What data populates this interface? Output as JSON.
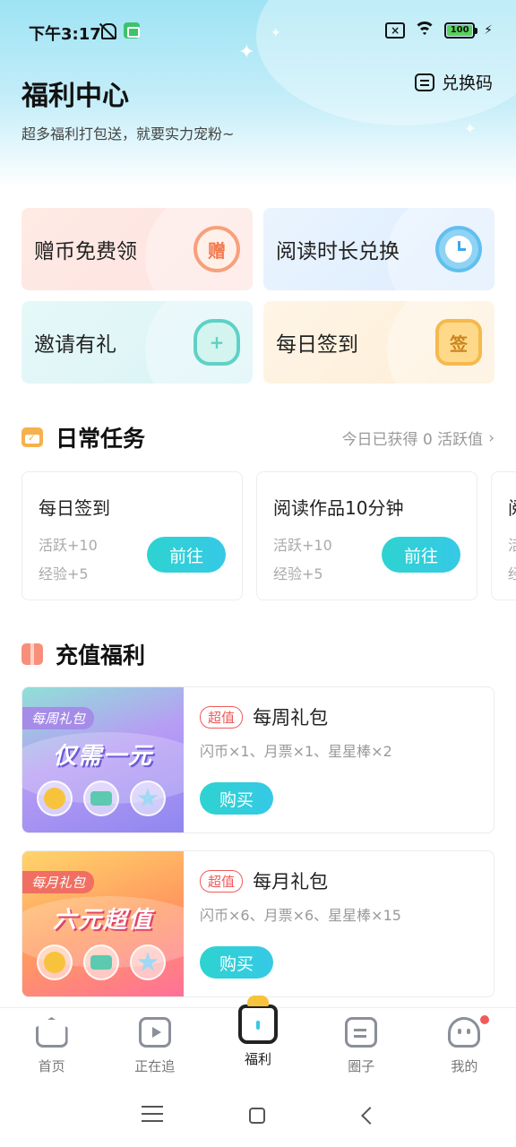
{
  "status_bar": {
    "time": "下午3:17",
    "battery": "100"
  },
  "header": {
    "title": "福利中心",
    "subtitle": "超多福利打包送，就要实力宠粉~",
    "redeem_label": "兑换码"
  },
  "features": [
    {
      "label": "赠币免费领",
      "icon": "gift-coin-icon",
      "icon_text": "赠"
    },
    {
      "label": "阅读时长兑换",
      "icon": "alarm-clock-icon"
    },
    {
      "label": "邀请有礼",
      "icon": "invite-user-icon"
    },
    {
      "label": "每日签到",
      "icon": "sign-in-badge-icon",
      "icon_text": "签"
    }
  ],
  "daily_tasks": {
    "title": "日常任务",
    "meta": "今日已获得 0 活跃值",
    "tasks": [
      {
        "name": "每日签到",
        "reward1": "活跃+10",
        "reward2": "经验+5",
        "button": "前往"
      },
      {
        "name": "阅读作品10分钟",
        "reward1": "活跃+10",
        "reward2": "经验+5",
        "button": "前往"
      },
      {
        "name": "阅",
        "reward1": "活",
        "reward2": "经",
        "button": ""
      }
    ]
  },
  "recharge": {
    "title": "充值福利",
    "packs": [
      {
        "ribbon": "每周礼包",
        "slogan": "仅需一元",
        "tag": "超值",
        "name": "每周礼包",
        "desc": "闪币×1、月票×1、星星棒×2",
        "button": "购买"
      },
      {
        "ribbon": "每月礼包",
        "slogan": "六元超值",
        "tag": "超值",
        "name": "每月礼包",
        "desc": "闪币×6、月票×6、星星棒×15",
        "button": "购买"
      }
    ]
  },
  "bottom_nav": [
    {
      "label": "首页",
      "icon": "home-icon"
    },
    {
      "label": "正在追",
      "icon": "tv-icon"
    },
    {
      "label": "福利",
      "icon": "welfare-icon",
      "active": true
    },
    {
      "label": "圈子",
      "icon": "chat-icon"
    },
    {
      "label": "我的",
      "icon": "profile-icon",
      "badge": true
    }
  ],
  "colors": {
    "accent": "#2ed3d0",
    "tag_red": "#f05a5a",
    "header_blue": "#9ee3f4"
  }
}
